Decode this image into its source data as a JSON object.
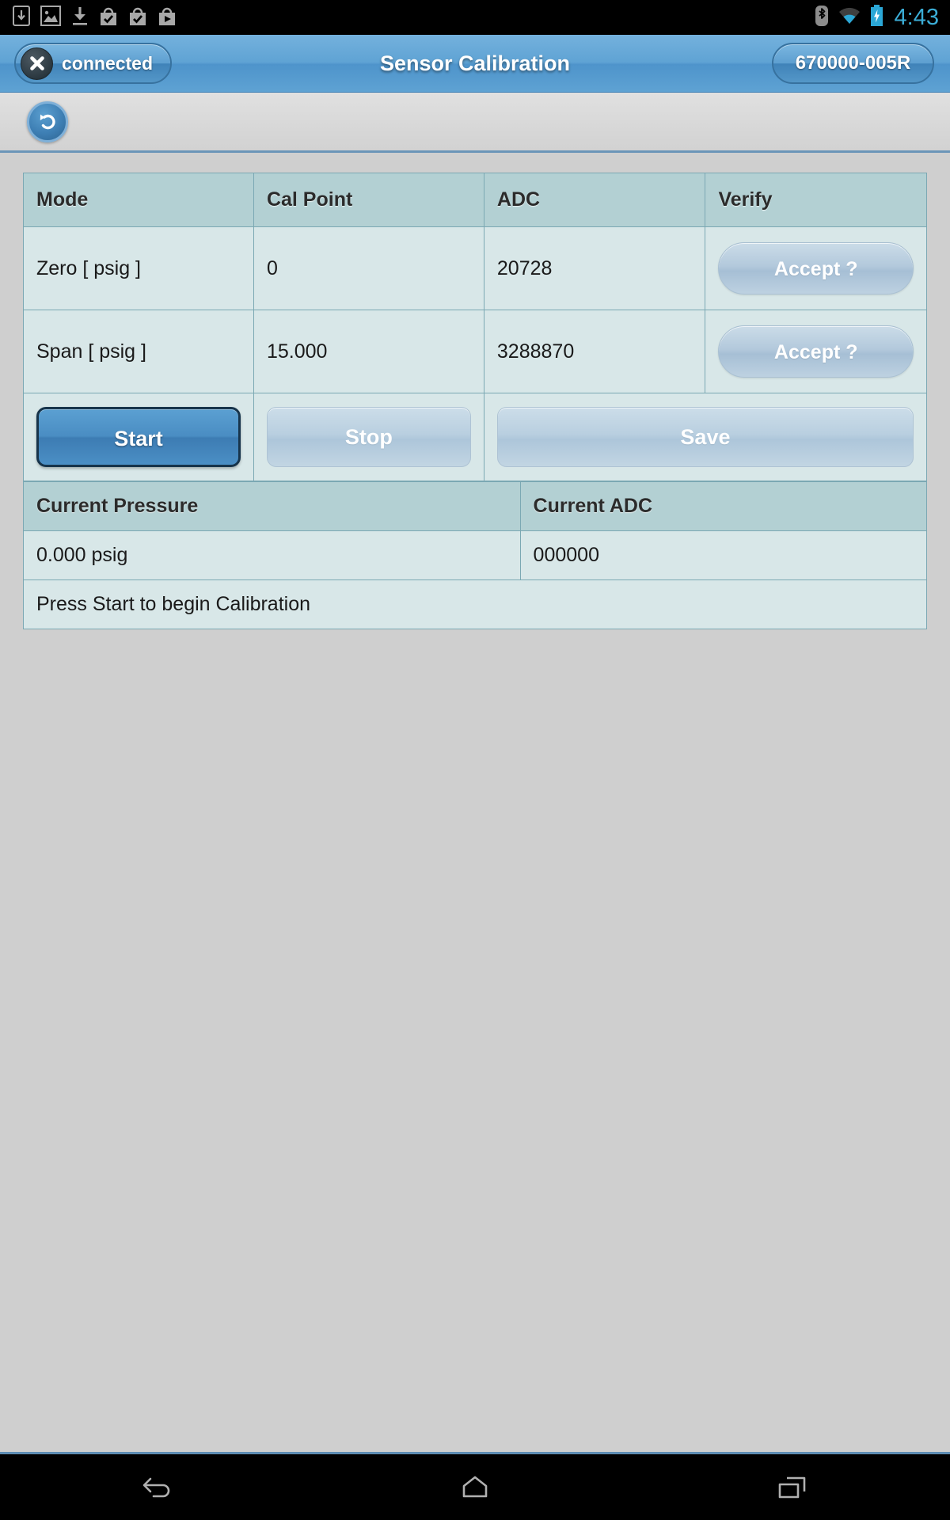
{
  "status_bar": {
    "icons": [
      "app-install-icon",
      "screenshot-image-icon",
      "download-icon",
      "play-store-bag-check-icon",
      "play-store-bag-check-icon-2",
      "play-store-bag-play-icon"
    ],
    "bluetooth_icon": "bluetooth-icon",
    "wifi_icon": "wifi-icon",
    "battery_icon": "battery-charging-icon",
    "time": "4:43",
    "time_color": "#3badd6"
  },
  "title_bar": {
    "connection_icon": "close-x-icon",
    "connection_label": "connected",
    "title": "Sensor Calibration",
    "device_id": "670000-005R",
    "accent_color": "#5ea2d3"
  },
  "action_bar": {
    "back_icon": "undo-arrow-icon",
    "back_label": "Back"
  },
  "cal_table": {
    "headers": [
      "Mode",
      "Cal Point",
      "ADC",
      "Verify"
    ],
    "rows": [
      {
        "mode": "Zero [ psig ]",
        "cal_point": "0",
        "adc": "20728",
        "verify_label": "Accept ?"
      },
      {
        "mode": "Span [ psig ]",
        "cal_point": "15.000",
        "adc": "3288870",
        "verify_label": "Accept ?"
      }
    ],
    "header_bg": "#b3d0d3",
    "cell_bg": "#d8e7e8"
  },
  "controls": {
    "start_label": "Start",
    "stop_label": "Stop",
    "save_label": "Save"
  },
  "summary": {
    "headers": [
      "Current Pressure",
      "Current ADC"
    ],
    "pressure_value": "0.000 psig",
    "adc_value": "000000"
  },
  "status_message": "Press Start to begin Calibration",
  "nav_bar": {
    "back_icon": "nav-back-icon",
    "home_icon": "nav-home-icon",
    "recents_icon": "nav-recents-icon"
  }
}
